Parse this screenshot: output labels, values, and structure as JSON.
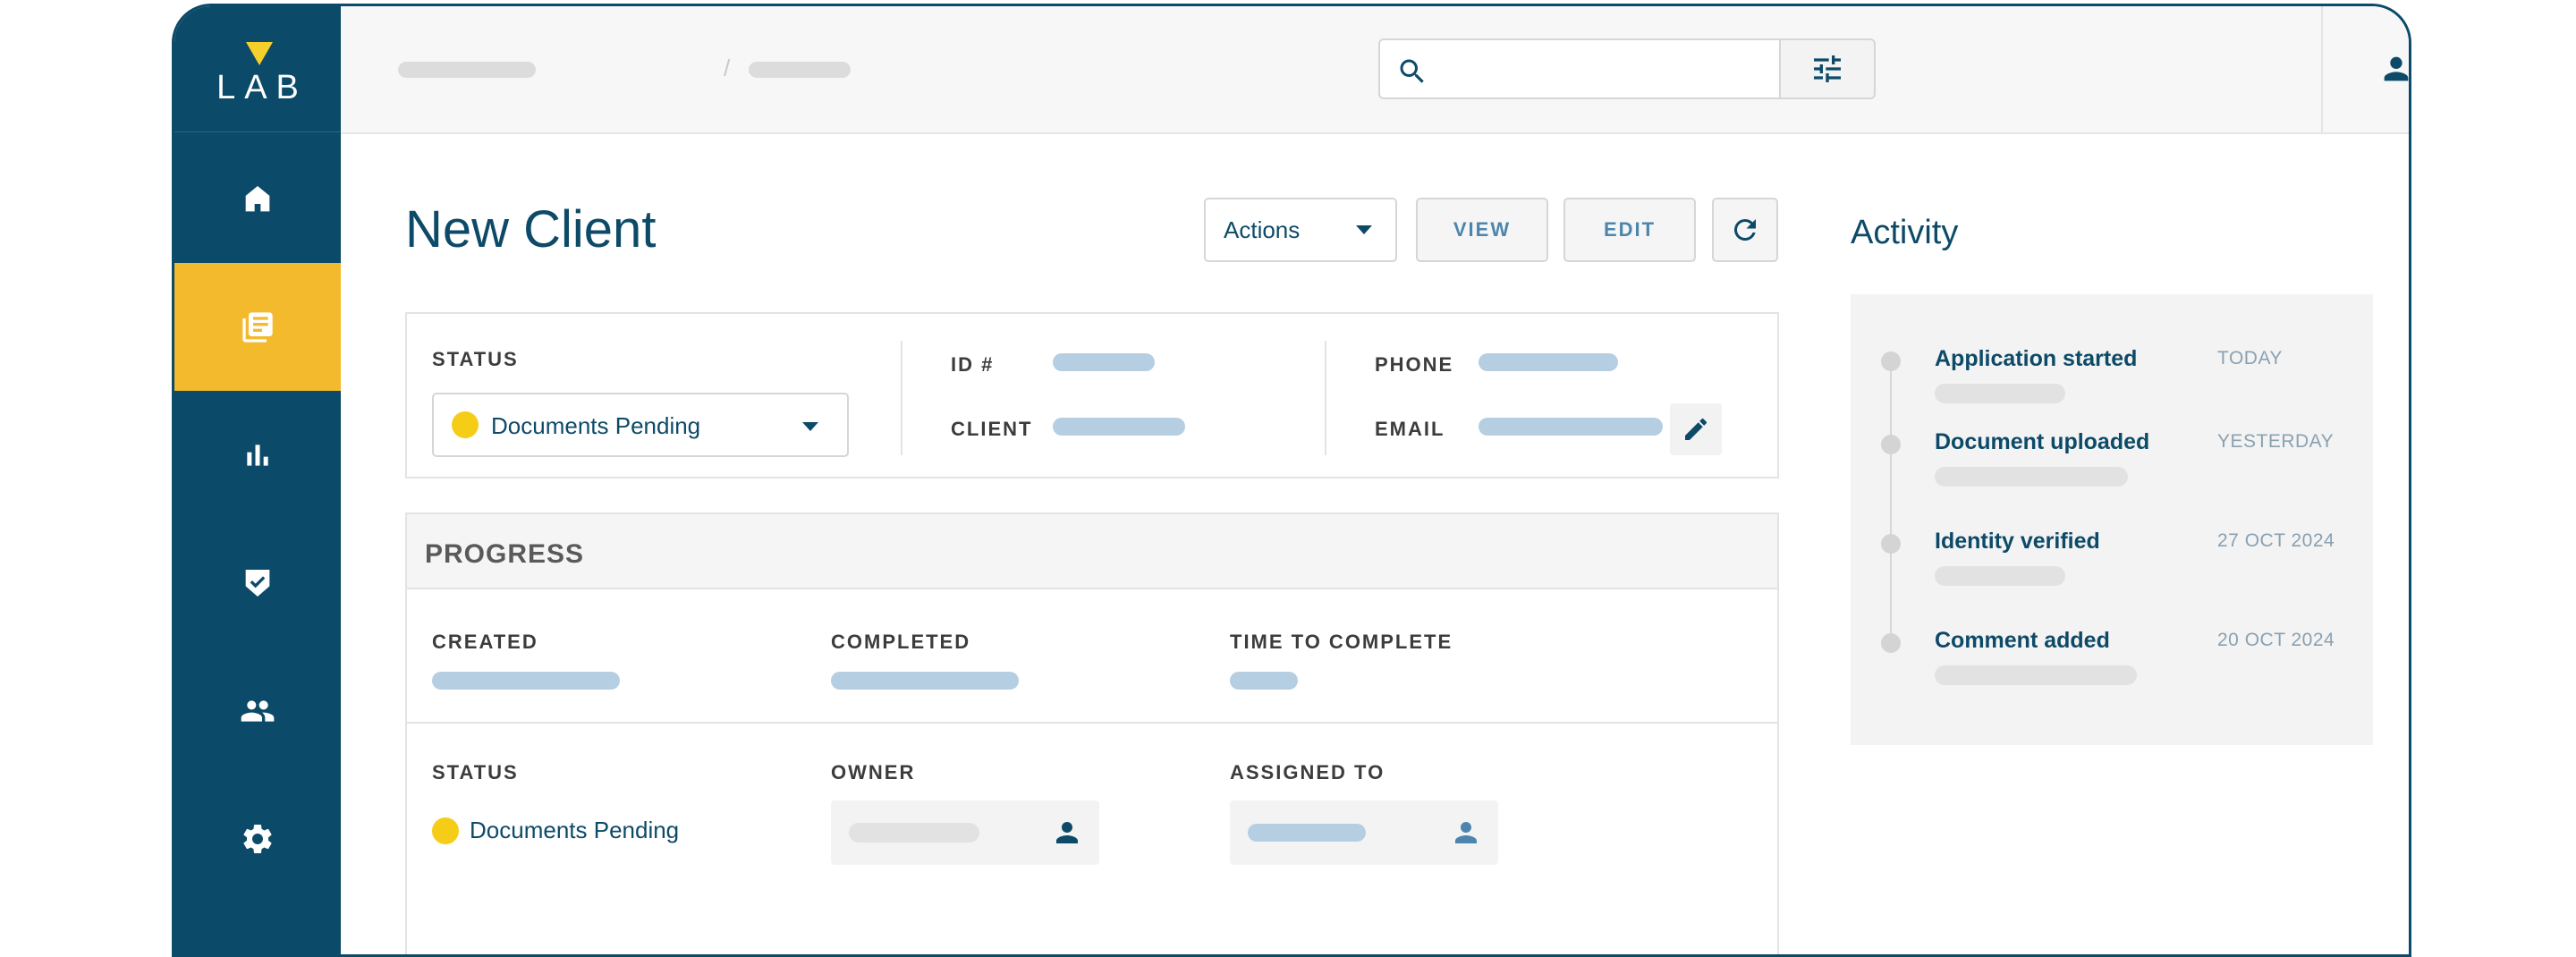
{
  "app": {
    "logo_text": "LAB"
  },
  "sidebar": {
    "items": [
      {
        "name": "home",
        "icon": "home-icon"
      },
      {
        "name": "documents",
        "icon": "documents-icon",
        "active": true
      },
      {
        "name": "reports",
        "icon": "bar-chart-icon"
      },
      {
        "name": "tasks",
        "icon": "shield-check-icon"
      },
      {
        "name": "users",
        "icon": "people-icon"
      },
      {
        "name": "settings",
        "icon": "gear-icon"
      }
    ]
  },
  "topbar": {
    "breadcrumb_separator": "/",
    "search": {
      "placeholder": ""
    },
    "icons": [
      "search-icon",
      "filter-icon",
      "user-icon",
      "bell-icon"
    ]
  },
  "main": {
    "title": "New Client",
    "actions_label": "Actions",
    "view_label": "VIEW",
    "edit_label": "EDIT",
    "details": {
      "status_label": "STATUS",
      "status_value": "Documents Pending",
      "status_color": "#f5cd17",
      "id_label": "ID #",
      "client_label": "CLIENT",
      "phone_label": "PHONE",
      "email_label": "EMAIL"
    },
    "progress": {
      "title": "PROGRESS",
      "created_label": "CREATED",
      "completed_label": "COMPLETED",
      "time_label": "TIME TO COMPLETE",
      "status_label": "STATUS",
      "status_value": "Documents Pending",
      "owner_label": "OWNER",
      "assigned_label": "ASSIGNED TO"
    }
  },
  "activity": {
    "title": "Activity",
    "items": [
      {
        "label": "Application started",
        "date": "TODAY"
      },
      {
        "label": "Document uploaded",
        "date": "YESTERDAY"
      },
      {
        "label": "Identity verified",
        "date": "27 OCT 2024"
      },
      {
        "label": "Comment added",
        "date": "20 OCT 2024"
      }
    ]
  },
  "colors": {
    "brand_dark": "#0b4a68",
    "accent_yellow": "#f2ba2c",
    "placeholder_blue": "#b6cee1",
    "placeholder_grey": "#e2e2e2"
  }
}
